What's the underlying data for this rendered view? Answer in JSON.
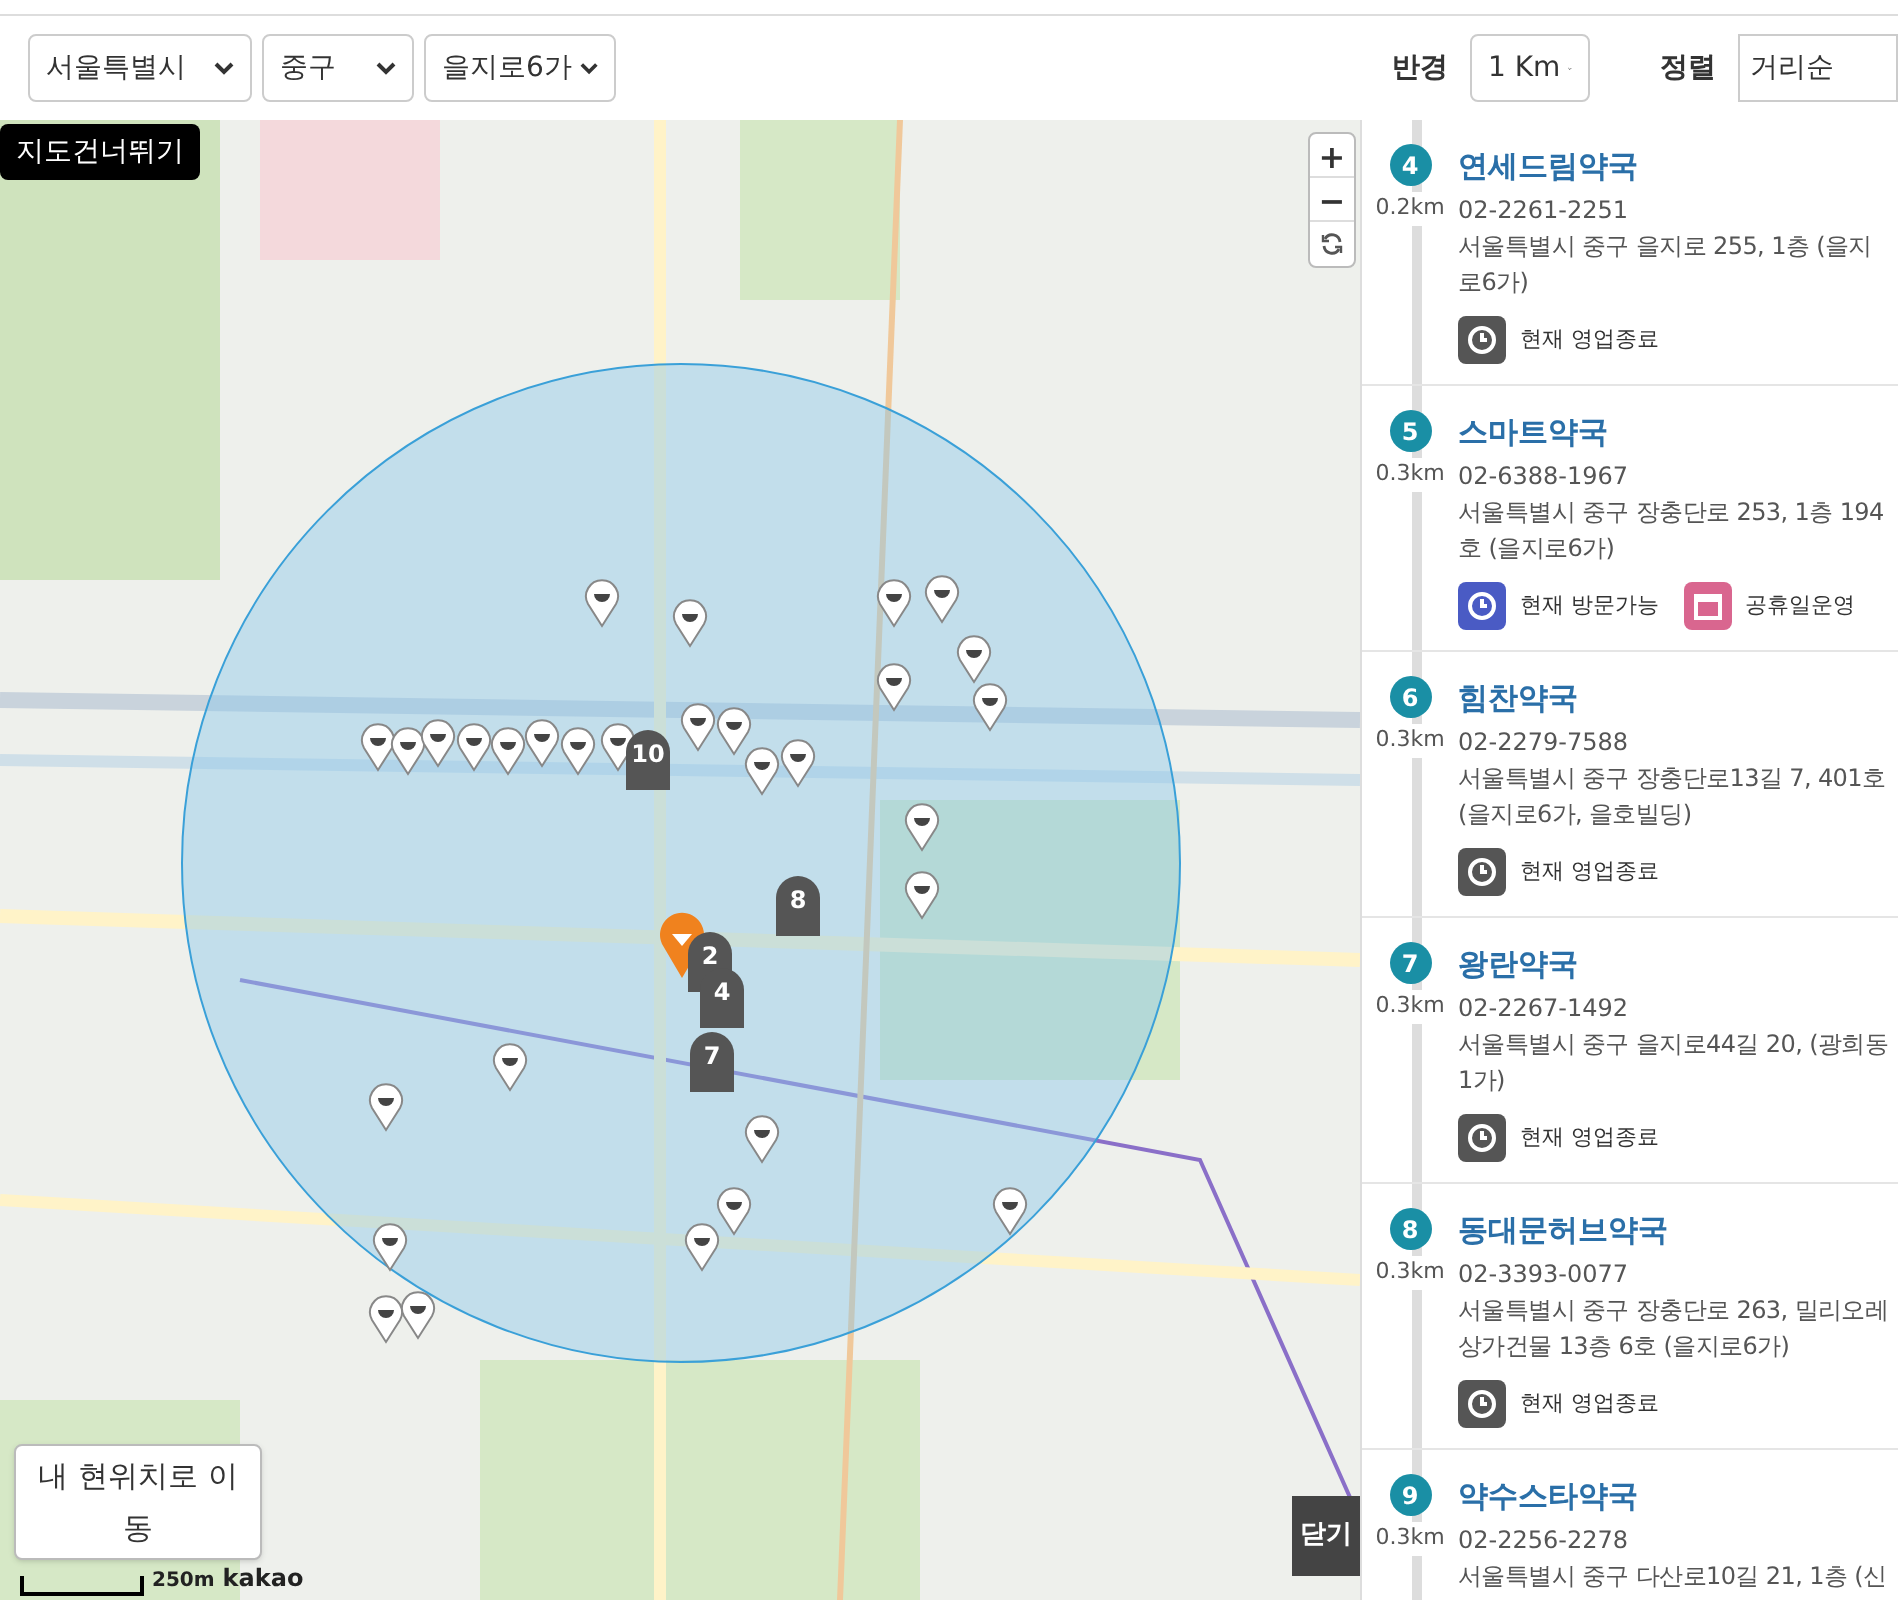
{
  "filters": {
    "city": "서울특별시",
    "district": "중구",
    "dong": "을지로6가",
    "radius_label": "반경",
    "radius": "1 Km",
    "sort_label": "정렬",
    "sort": "거리순"
  },
  "map": {
    "skip_button": "지도건너뛰기",
    "zoom_in": "+",
    "zoom_out": "−",
    "locate_button": "내 현위치로 이동",
    "scale": "250m",
    "logo": "kakao",
    "close_button": "닫기",
    "numbered_pins": [
      "10",
      "8",
      "2",
      "4",
      "7"
    ]
  },
  "pharmacies": [
    {
      "number": "4",
      "distance": "0.2km",
      "name": "연세드림약국",
      "phone": "02-2261-2251",
      "address": "서울특별시 중구 을지로 255, 1층 (을지로6가)",
      "badges": [
        {
          "kind": "closed",
          "label": "현재 영업종료"
        }
      ]
    },
    {
      "number": "5",
      "distance": "0.3km",
      "name": "스마트약국",
      "phone": "02-6388-1967",
      "address": "서울특별시 중구 장충단로 253, 1층 194호 (을지로6가)",
      "badges": [
        {
          "kind": "open",
          "label": "현재 방문가능"
        },
        {
          "kind": "holiday",
          "label": "공휴일운영"
        }
      ]
    },
    {
      "number": "6",
      "distance": "0.3km",
      "name": "힘찬약국",
      "phone": "02-2279-7588",
      "address": "서울특별시 중구 장충단로13길 7, 401호 (을지로6가, 을호빌딩)",
      "badges": [
        {
          "kind": "closed",
          "label": "현재 영업종료"
        }
      ]
    },
    {
      "number": "7",
      "distance": "0.3km",
      "name": "왕란약국",
      "phone": "02-2267-1492",
      "address": "서울특별시 중구 을지로44길 20, (광희동1가)",
      "badges": [
        {
          "kind": "closed",
          "label": "현재 영업종료"
        }
      ]
    },
    {
      "number": "8",
      "distance": "0.3km",
      "name": "동대문허브약국",
      "phone": "02-3393-0077",
      "address": "서울특별시 중구 장충단로 263, 밀리오레 상가건물 13층 6호 (을지로6가)",
      "badges": [
        {
          "kind": "closed",
          "label": "현재 영업종료"
        }
      ]
    },
    {
      "number": "9",
      "distance": "0.3km",
      "name": "약수스타약국",
      "phone": "02-2256-2278",
      "address": "서울특별시 중구 다산로10길 21, 1층 (신"
    }
  ]
}
